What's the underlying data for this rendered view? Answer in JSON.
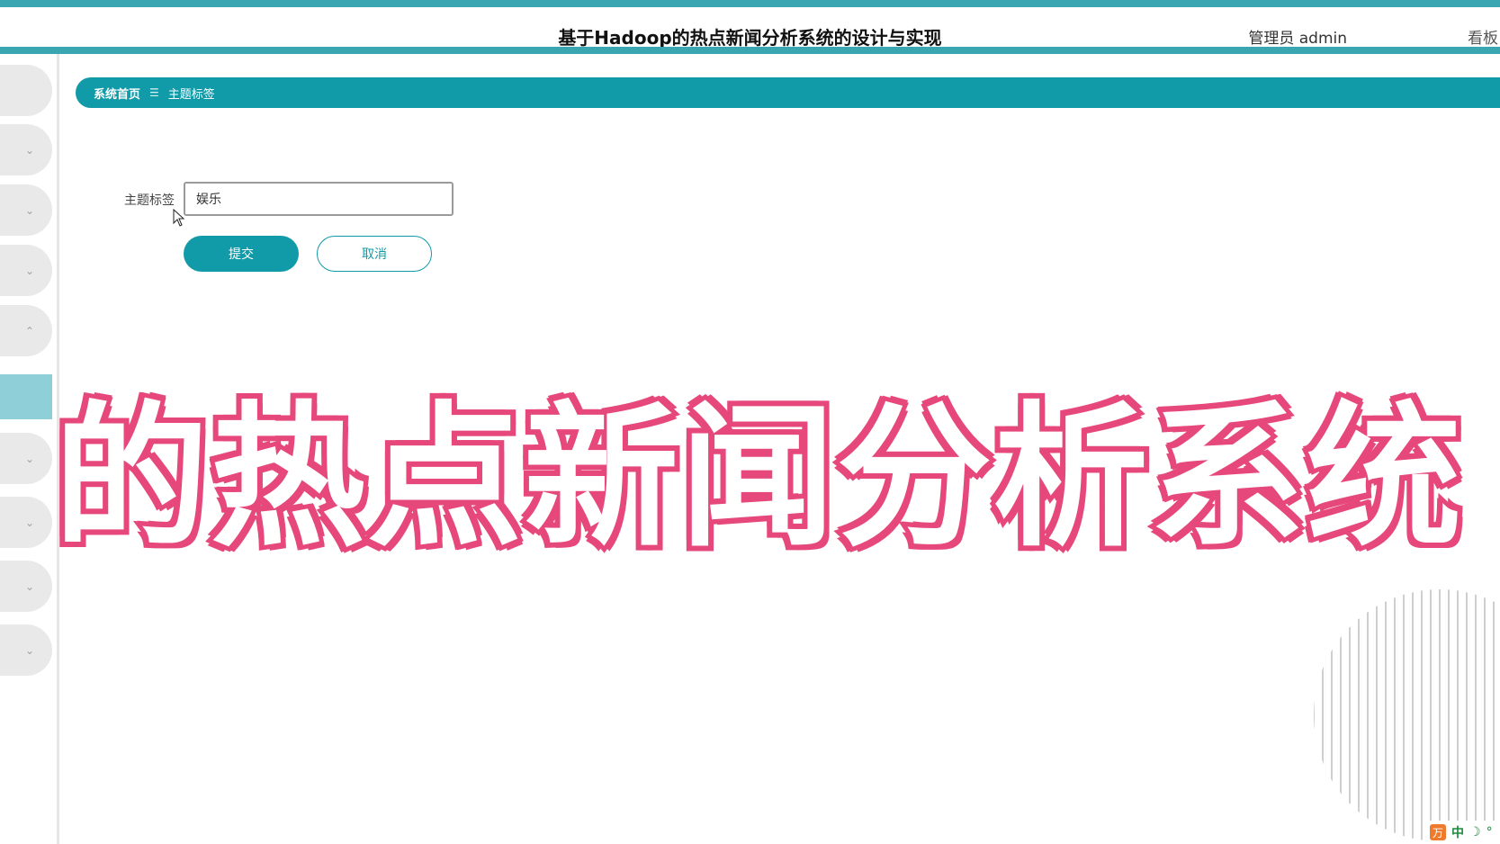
{
  "header": {
    "title": "基于Hadoop的热点新闻分析系统的设计与实现",
    "admin_label": "管理员 admin",
    "board_link": "看板"
  },
  "sidebar": {
    "items": [
      {
        "chevron": ""
      },
      {
        "chevron": "⌄"
      },
      {
        "chevron": "⌄"
      },
      {
        "chevron": "⌄"
      },
      {
        "chevron": "⌃"
      },
      {
        "chevron": "⌄"
      },
      {
        "chevron": "⌄"
      },
      {
        "chevron": "⌄"
      },
      {
        "chevron": "⌄"
      }
    ]
  },
  "breadcrumb": {
    "home": "系统首页",
    "separator": "☰",
    "current": "主题标签"
  },
  "form": {
    "label": "主题标签",
    "value": "娱乐",
    "submit_label": "提交",
    "cancel_label": "取消"
  },
  "overlay": {
    "text": "的热点新闻分析系统"
  },
  "ime": {
    "logo": "万",
    "mode": "中",
    "moon": "☽",
    "dot": "°"
  },
  "colors": {
    "accent": "#119aa8",
    "stripe": "#3aa6b1",
    "overlay_stroke": "#e6487c"
  }
}
